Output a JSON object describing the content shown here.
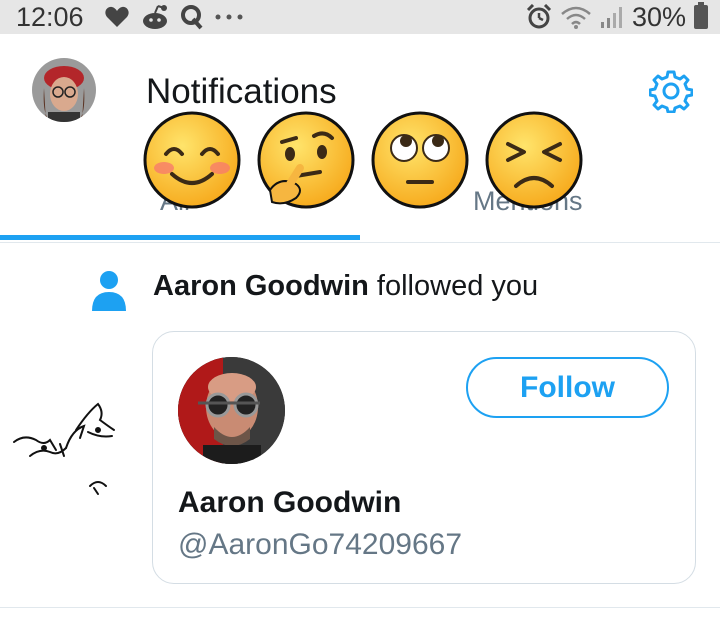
{
  "status_bar": {
    "time": "12:06",
    "battery": "30%",
    "left_icons": [
      "heart-icon",
      "reddit-icon",
      "quora-icon",
      "more-dots-icon"
    ],
    "right_icons": [
      "alarm-icon",
      "wifi-icon",
      "signal-icon",
      "battery-icon"
    ]
  },
  "header": {
    "title": "Notifications",
    "settings_icon": "gear-icon"
  },
  "tabs": [
    {
      "label": "All",
      "selected": true
    },
    {
      "label": "Mentions",
      "selected": false
    }
  ],
  "overlay_emojis": [
    "smiling-face-emoji",
    "thinking-face-emoji",
    "eye-roll-emoji",
    "persevering-face-emoji"
  ],
  "notification": {
    "type_icon": "person-icon",
    "actor": "Aaron Goodwin",
    "action": " followed you",
    "card": {
      "name": "Aaron Goodwin",
      "handle": "@AaronGo74209667",
      "follow_label": "Follow"
    }
  },
  "colors": {
    "accent": "#1da1f2",
    "text_primary": "#14171a",
    "text_secondary": "#657786",
    "status_bar_bg": "#e6e6e6"
  }
}
